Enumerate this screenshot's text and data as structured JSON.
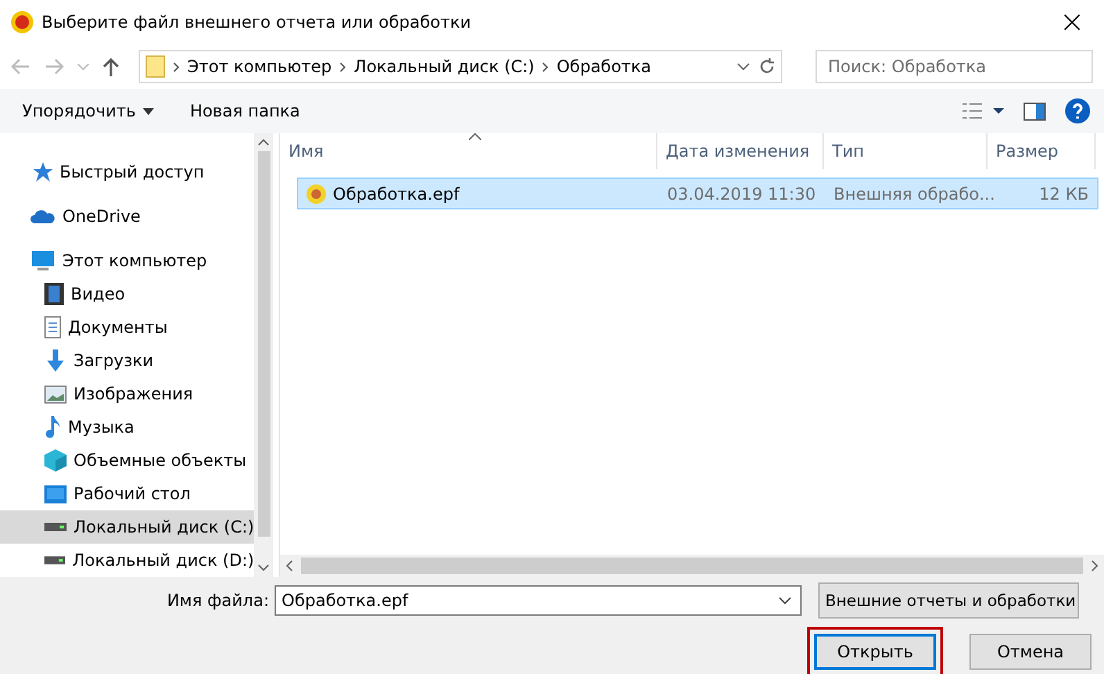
{
  "window": {
    "title": "Выберите файл внешнего отчета или обработки",
    "close": "×"
  },
  "address": {
    "crumbs": [
      "Этот компьютер",
      "Локальный диск (C:)",
      "Обработка"
    ]
  },
  "search": {
    "placeholder": "Поиск: Обработка"
  },
  "toolbar": {
    "organize": "Упорядочить",
    "new_folder": "Новая папка"
  },
  "sidebar": {
    "items": [
      {
        "label": "Быстрый доступ",
        "kind": "star",
        "selected": false
      },
      {
        "label": "OneDrive",
        "kind": "cloud",
        "selected": false
      },
      {
        "label": "Этот компьютер",
        "kind": "computer",
        "selected": false,
        "children": [
          {
            "label": "Видео",
            "kind": "video",
            "selected": false
          },
          {
            "label": "Документы",
            "kind": "documents",
            "selected": false
          },
          {
            "label": "Загрузки",
            "kind": "downloads",
            "selected": false
          },
          {
            "label": "Изображения",
            "kind": "pictures",
            "selected": false
          },
          {
            "label": "Музыка",
            "kind": "music",
            "selected": false
          },
          {
            "label": "Объемные объекты",
            "kind": "objects",
            "selected": false
          },
          {
            "label": "Рабочий стол",
            "kind": "desktop",
            "selected": false
          },
          {
            "label": "Локальный диск (C:)",
            "kind": "drive",
            "selected": true
          },
          {
            "label": "Локальный диск (D:)",
            "kind": "drive",
            "selected": false
          }
        ]
      }
    ]
  },
  "table": {
    "columns": [
      {
        "label": "Имя",
        "sorted": true
      },
      {
        "label": "Дата изменения",
        "sorted": false
      },
      {
        "label": "Тип",
        "sorted": false
      },
      {
        "label": "Размер",
        "sorted": false
      }
    ],
    "rows": [
      {
        "name": "Обработка.epf",
        "date": "03.04.2019 11:30",
        "type": "Внешняя обрабо...",
        "size": "12 КБ",
        "selected": true
      }
    ]
  },
  "footer": {
    "filename_label": "Имя файла:",
    "filename": "Обработка.epf",
    "filter": "Внешние отчеты и обработки",
    "buttons": [
      {
        "label": "Открыть",
        "highlighted": true
      },
      {
        "label": "Отмена",
        "highlighted": false
      }
    ]
  }
}
